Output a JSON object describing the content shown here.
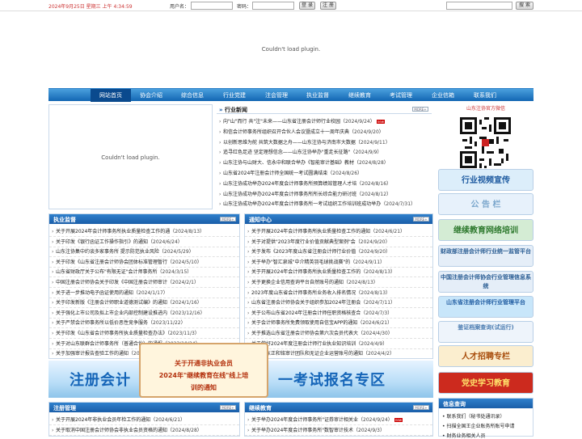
{
  "topbar": {
    "datetime": "2024年9月25日 星期三 上午 4:34:59",
    "username_label": "用户名：",
    "password_label": "密码：",
    "login_label": "登 录",
    "register_label": "注 册",
    "search_label": "搜 索"
  },
  "plugin_message": "Couldn't load plugin.",
  "nav": [
    "网站首页",
    "协会介绍",
    "综合信息",
    "行业党建",
    "注会管理",
    "执业监督",
    "继续教育",
    "考试管理",
    "企业信箱",
    "联系我们"
  ],
  "news": {
    "title": "行业新闻",
    "more": "MORE+",
    "items": [
      {
        "text": "向\"山\"而行 共\"注\"未来——山东省注册会计师行业校园（",
        "date": "2024/9/24",
        "suffix": "）",
        "new": true
      },
      {
        "text": "和信会计师事务所组织召开合伙人会议暨成立十一周年庆典（",
        "date": "2024/9/20",
        "suffix": "）"
      },
      {
        "text": "以创新思维为舵 共筑大数据之舟——山东注协与济南市大数据（",
        "date": "2024/9/11",
        "suffix": "）"
      },
      {
        "text": "追寻红色足迹 坚定理想信念——山东注协举办\"重走长征路\"（",
        "date": "2024/9/9",
        "suffix": "）"
      },
      {
        "text": "山东注协与山财大、信永中和联合举办《智能审计基础》教材（",
        "date": "2024/8/28",
        "suffix": "）"
      },
      {
        "text": "山东省2024年注册会计师全国统一考试圆满结束（",
        "date": "2024/8/26",
        "suffix": "）"
      },
      {
        "text": "山东注协成功举办2024年度会计师事务所预算绩效管理人才培（",
        "date": "2024/8/16",
        "suffix": "）"
      },
      {
        "text": "山东注协成功举办2024年度会计师事务所所长综合能力研讨班（",
        "date": "2024/8/12",
        "suffix": "）"
      },
      {
        "text": "山东注协成功举办2024年度会计师事务所一考试组织工作培训班成功举办（",
        "date": "2024/7/31",
        "suffix": "）"
      }
    ]
  },
  "supervision": {
    "title": "执业监督",
    "more": "MORE+",
    "items": [
      {
        "text": "关于开展2024年会计师事务所执业质量检查工作的通（",
        "date": "2024/8/13",
        "suffix": "）"
      },
      {
        "text": "关于印发《银行函证工作操作指引》的通知（",
        "date": "2024/6/24",
        "suffix": "）"
      },
      {
        "text": "山东注协集中约谈多家事务所 提示防范执业风险（",
        "date": "2024/5/29",
        "suffix": "）"
      },
      {
        "text": "关于印发《山东省注册会计师协会团体标准管理暂行（",
        "date": "2024/5/10",
        "suffix": "）"
      },
      {
        "text": "山东省财政厅关于公布\"有限无证\"会计师事务所（",
        "date": "2024/3/15",
        "suffix": "）"
      },
      {
        "text": "中国注册会计师协会关于印发《中国注册会计师审计（",
        "date": "2024/2/1",
        "suffix": "）"
      },
      {
        "text": "关于进一步推动电子函证使用的通知（",
        "date": "2024/1/17",
        "suffix": "）"
      },
      {
        "text": "关于印发新版《注册会计师职业道德测试编》的通知（",
        "date": "2024/1/16",
        "suffix": "）"
      },
      {
        "text": "关于强化上市公司及拟上市企业内部控制建设推进内（",
        "date": "2023/12/16",
        "suffix": "）"
      },
      {
        "text": "关于严禁会计师事务所以低价恶性竞争服务（",
        "date": "2023/11/22",
        "suffix": "）"
      },
      {
        "text": "关于印发《山东省会计师事务所执业质量检查办法》（",
        "date": "2023/11/3",
        "suffix": "）"
      },
      {
        "text": "关于对山东联群会计师事务所（普通合伙）的通报（",
        "date": "2023/10/24",
        "suffix": "）"
      },
      {
        "text": "关于加强审计报告查验工作的通知（",
        "date": "2023/9/18",
        "suffix": "）"
      }
    ]
  },
  "notices": {
    "title": "通知中心",
    "more": "MORE+",
    "items": [
      {
        "text": "关于开展2024年会计师事务所执业质量检查工作的通知（",
        "date": "2024/6/21",
        "suffix": "）"
      },
      {
        "text": "关于对提供\"2023年度行业价值贡献典型案例\"会（",
        "date": "2024/9/20",
        "suffix": "）"
      },
      {
        "text": "关于发布《2023年度山东省注册会计师行业价值（",
        "date": "2024/9/20",
        "suffix": "）"
      },
      {
        "text": "关于举办\"智汇泉城\"中介精英羽毛球挑战赛\"的（",
        "date": "2024/9/11",
        "suffix": "）"
      },
      {
        "text": "关于开展2024年会计师事务所执业质量检查工作的（",
        "date": "2024/8/13",
        "suffix": "）"
      },
      {
        "text": "关于更换企业信用查询平台自然账号的通知（",
        "date": "2024/8/13",
        "suffix": "）"
      },
      {
        "text": "2023年度山东省会计师事务所业务收入排名情况（",
        "date": "2024/8/13",
        "suffix": "）"
      },
      {
        "text": "山东省注册会计师协会关于组织参加2024年注册会（",
        "date": "2024/7/11",
        "suffix": "）"
      },
      {
        "text": "关于公布山东省2024年注册会计师任职资格核查合（",
        "date": "2024/7/3",
        "suffix": "）"
      },
      {
        "text": "关于会计师事务所免费领取使用自信宝APP的通知（",
        "date": "2024/6/21",
        "suffix": "）"
      },
      {
        "text": "关于推选山东省注册会计师协会第六次会员代表大（",
        "date": "2024/4/30",
        "suffix": "）"
      },
      {
        "text": "关于做好2024年度注册会计师行业执业知识培训（",
        "date": "2024/4/9",
        "suffix": "）"
      },
      {
        "text": "关于山东正和铭审计团队和无证企业运营账号的通知（",
        "date": "2024/4/2",
        "suffix": "）"
      }
    ]
  },
  "banner": {
    "left_text": "注册会计",
    "right_text": "一考试报名专区"
  },
  "popup": {
    "line1": "关于开通非执业会员",
    "line2": "2024年\"继续教育在线\"线上培",
    "line3": "训的通知"
  },
  "cpa_mgmt": {
    "title": "注册管理",
    "more": "MORE+",
    "items": [
      {
        "text": "关于开展2024年非执业会员年检工作的通知（",
        "date": "2024/6/21",
        "suffix": "）"
      },
      {
        "text": "关于取消中国注册会计师协会非执业会员资格的通知（",
        "date": "2024/8/28",
        "suffix": "）"
      }
    ]
  },
  "edu": {
    "title": "继续教育",
    "more": "MORE+",
    "items": [
      {
        "text": "关于举办2024年度会计师事务所\"证券审计相关业（",
        "date": "2024/9/24",
        "suffix": "）",
        "new": true
      },
      {
        "text": "关于举办2024年度会计师事务所\"数智审计技术（",
        "date": "2024/9/3",
        "suffix": "）"
      }
    ]
  },
  "sidebar": {
    "wechat_title": "山东注协官方微信",
    "buttons": [
      {
        "label": "行业视频宣传",
        "bg": "#dceefa",
        "color": "#1d5aa0"
      },
      {
        "label": "公 告 栏",
        "bg": "#e7f1fb",
        "color": "#7aa6cc"
      },
      {
        "label": "继续教育网络培训",
        "bg": "#d4ecd4",
        "color": "#2f7a2f"
      },
      {
        "label": "财政部注册会计师行业统一监管平台",
        "bg": "#e5eef8",
        "color": "#2a5d93"
      },
      {
        "label": "中国注册会计师协会行业管理信息系统",
        "bg": "#e5eef8",
        "color": "#2a5d93"
      },
      {
        "label": "山东省注册会计师行业管理平台",
        "bg": "#c8e6fa",
        "color": "#1d5aa0"
      },
      {
        "label": "鉴证档案查询(试运行)",
        "bg": "#eef4fb",
        "color": "#4a7bb0"
      },
      {
        "label": "人才招聘专栏",
        "bg": "#fbeecf",
        "color": "#a84d0c"
      },
      {
        "label": "党史学习教育",
        "bg": "#cc2a1e",
        "color": "#ffe16a"
      }
    ],
    "info_title": "信息查询",
    "info_items": [
      "联系我们（秘书处通讯录）",
      "扫描全国王企业账务所账号申请",
      "财务业务相关人员"
    ]
  }
}
